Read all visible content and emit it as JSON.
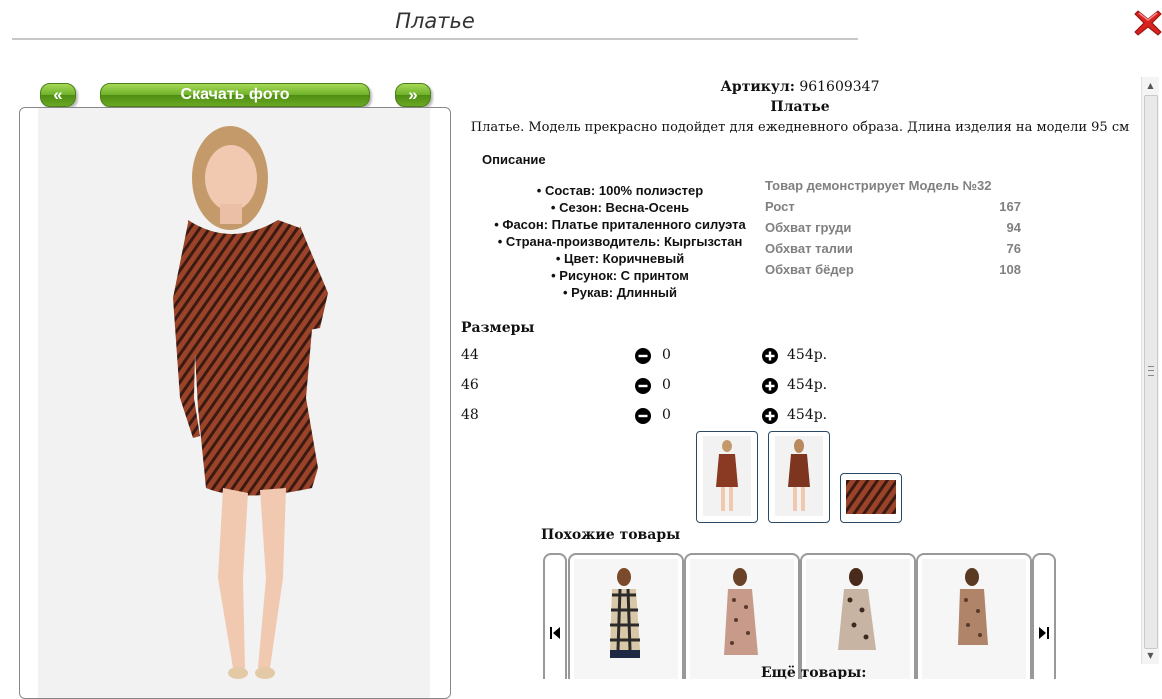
{
  "header": {
    "title": "Платье"
  },
  "nav": {
    "prev_label": "«",
    "download_label": "Скачать фото",
    "next_label": "»"
  },
  "product": {
    "article_label": "Артикул:",
    "article_value": "961609347",
    "name": "Платье",
    "short_description": "Платье. Модель прекрасно подойдет для ежедневного образа. Длина изделия на модели 95 см",
    "description_heading": "Описание",
    "features": [
      "• Состав: 100% полиэстер",
      "• Сезон: Весна-Осень",
      "• Фасон: Платье приталенного силуэта",
      "• Страна-производитель: Кыргызстан",
      "• Цвет: Коричневый",
      "• Рисунок: С принтом",
      "• Рукав: Длинный"
    ],
    "model": {
      "heading": "Товар демонстрирует Модель №32",
      "rows": [
        {
          "label": "Рост",
          "value": "167"
        },
        {
          "label": "Обхват груди",
          "value": "94"
        },
        {
          "label": "Обхват талии",
          "value": "76"
        },
        {
          "label": "Обхват бёдер",
          "value": "108"
        }
      ]
    }
  },
  "sizes": {
    "heading": "Размеры",
    "rows": [
      {
        "size": "44",
        "qty": "0",
        "price": "454р."
      },
      {
        "size": "46",
        "qty": "0",
        "price": "454р."
      },
      {
        "size": "48",
        "qty": "0",
        "price": "454р."
      }
    ]
  },
  "similar": {
    "heading": "Похожие товары"
  },
  "more": {
    "heading": "Ещё товары:"
  },
  "colors": {
    "dress": "#8a3a22",
    "green": "#6fb12a",
    "close": "#d9211f"
  }
}
